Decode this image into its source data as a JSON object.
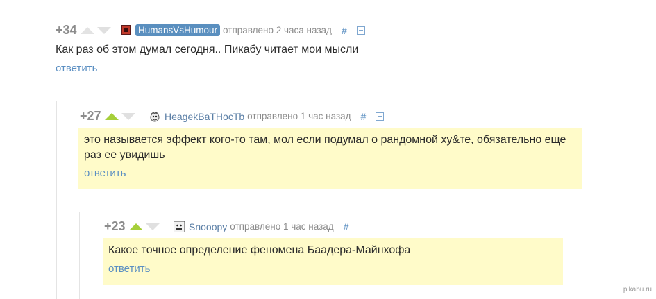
{
  "comments": [
    {
      "rating": "+34",
      "user": "HumansVsHumour",
      "time": "отправлено 2 часа назад",
      "hash": "#",
      "text": "Как раз об этом думал сегодня.. Пикабу читает мои мысли",
      "reply": "ответить",
      "avatar_icon": "red-square-avatar-icon"
    },
    {
      "rating": "+27",
      "user": "HeagekBaTHocTb",
      "time": "отправлено 1 час назад",
      "hash": "#",
      "text": "это называется эффект кого-то там, мол если подумал о рандомной ху&те, обязательно еще раз ее увидишь",
      "reply": "ответить",
      "avatar_icon": "cartoon-face-avatar-icon"
    },
    {
      "rating": "+23",
      "user": "Snooopy",
      "time": "отправлено 1 час назад",
      "hash": "#",
      "text": "Какое точное определение феномена Баадера-Майнхофа",
      "reply": "ответить",
      "avatar_icon": "face-avatar-icon"
    }
  ],
  "watermark": "pikabu.ru",
  "colors": {
    "highlight": "#fffbc9",
    "link": "#5b8fc2",
    "upvote": "#a6cf3a"
  }
}
